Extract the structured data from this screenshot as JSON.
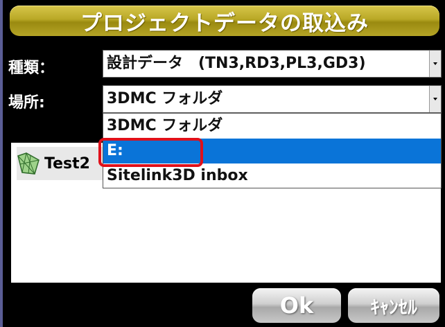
{
  "dialog": {
    "title": "プロジェクトデータの取込み"
  },
  "type_field": {
    "label": "種類：",
    "value": "設計データ　(TN3,RD3,PL3,GD3)"
  },
  "location_field": {
    "label": "場所:",
    "value": "3DMC フォルダ",
    "options": [
      {
        "label": "3DMC フォルダ"
      },
      {
        "label": "E:"
      },
      {
        "label": "Sitelink3D inbox"
      }
    ],
    "selected_option": "E:"
  },
  "file_list": {
    "items": [
      {
        "name": "Test2",
        "icon": "surface-file-icon"
      }
    ]
  },
  "buttons": {
    "ok": "Ok",
    "cancel": "ｷｬﾝｾﾙ"
  },
  "colors": {
    "title_bar": "#b9a826",
    "selection": "#0a74d8",
    "highlight": "#e0101a"
  }
}
